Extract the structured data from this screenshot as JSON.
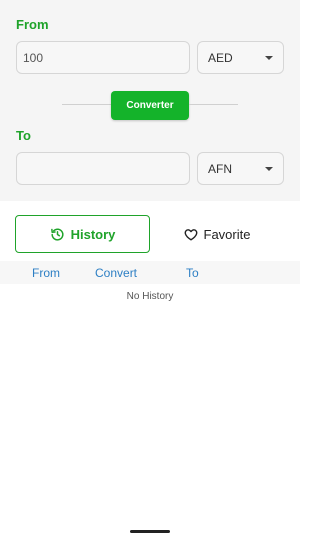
{
  "converter": {
    "from_label": "From",
    "from_amount": "100",
    "from_currency": "AED",
    "button_label": "Converter",
    "to_label": "To",
    "to_amount": "",
    "to_currency": "AFN"
  },
  "tabs": {
    "history_label": "History",
    "favorite_label": "Favorite",
    "active": "History"
  },
  "table": {
    "columns": [
      "From",
      "Convert",
      "To"
    ],
    "empty_message": "No History"
  },
  "colors": {
    "accent": "#1fa32a",
    "button": "#14b32a",
    "column_text": "#2d7fc4"
  },
  "icons": {
    "history": "history-icon",
    "favorite": "heart-outline-icon",
    "dropdown": "chevron-down-icon"
  }
}
